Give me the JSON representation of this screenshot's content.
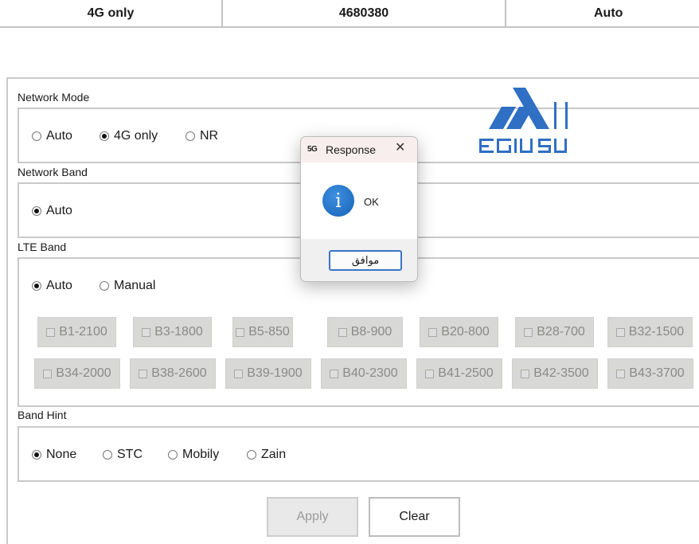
{
  "top_row": {
    "mode": "4G only",
    "cell_id": "4680380",
    "band": "Auto"
  },
  "network_mode": {
    "label": "Network Mode",
    "options": [
      "Auto",
      "4G only",
      "NR"
    ],
    "selected": "4G only"
  },
  "network_band": {
    "label": "Network Band",
    "options": [
      "Auto"
    ],
    "selected": "Auto"
  },
  "lte_band": {
    "label": "LTE Band",
    "options": [
      "Auto",
      "Manual"
    ],
    "selected": "Auto",
    "bands_row1": [
      "B1-2100",
      "B3-1800",
      "B5-850",
      "B8-900",
      "B20-800",
      "B28-700",
      "B32-1500"
    ],
    "bands_row2": [
      "B34-2000",
      "B38-2600",
      "B39-1900",
      "B40-2300",
      "B41-2500",
      "B42-3500",
      "B43-3700"
    ]
  },
  "band_hint": {
    "label": "Band Hint",
    "options": [
      "None",
      "STC",
      "Mobily",
      "Zain"
    ],
    "selected": "None"
  },
  "buttons": {
    "apply": "Apply",
    "clear": "Clear"
  },
  "dialog": {
    "app_icon": "5G",
    "title": "Response",
    "close": "✕",
    "info_glyph": "i",
    "message": "OK",
    "ok_button": "موافق"
  },
  "colors": {
    "logo_blue": "#2f6fc4",
    "info_blue": "#1a6fc9",
    "ok_border": "#3a74c8"
  }
}
